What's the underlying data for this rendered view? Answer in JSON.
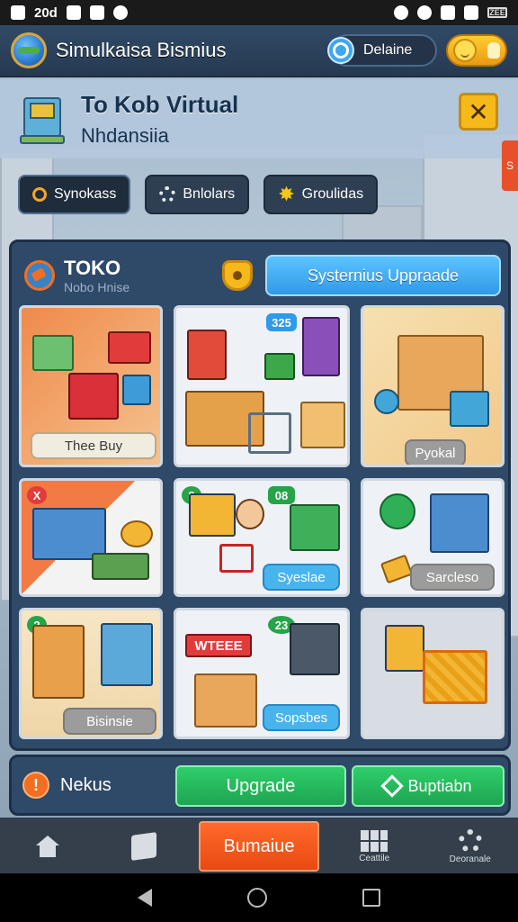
{
  "status_bar": {
    "time": "20d",
    "battery": "ZEE"
  },
  "header": {
    "app_title": "Simulkaisa Bismius",
    "search_label": "Delaine"
  },
  "title_panel": {
    "title": "To Kob Virtual",
    "subtitle": "Nhdansiia",
    "side_tag": "S"
  },
  "chips": [
    {
      "label": "Synokass",
      "icon": "search-icon"
    },
    {
      "label": "Bnlolars",
      "icon": "gear-icon"
    },
    {
      "label": "Groulidas",
      "icon": "star-icon"
    }
  ],
  "store": {
    "title": "TOKO",
    "subtitle": "Nobo Hnise",
    "upgrade_button": "Systernius Uppraade"
  },
  "cards": [
    {
      "label": "Thee Buy",
      "label_style": "cream"
    },
    {
      "label": "",
      "badge": "325"
    },
    {
      "label": "Pyokal",
      "label_style": "grey"
    },
    {
      "label": "",
      "badge": "X"
    },
    {
      "label": "Syeslae",
      "label_style": "blue",
      "badge": "8",
      "badge2": "08"
    },
    {
      "label": "Sarcleso",
      "label_style": "grey"
    },
    {
      "label": "Bisinsie",
      "label_style": "grey",
      "badge": "2"
    },
    {
      "label": "Sopsbes",
      "label_style": "blue",
      "badge": "23",
      "sign": "WTEEE"
    },
    {
      "label": ""
    }
  ],
  "actions": {
    "info_label": "Nekus",
    "upgrade_button": "Upgrade",
    "duplicate_button": "Buptiabn"
  },
  "bottom_nav": {
    "center_button": "Bumaiue",
    "item4_label": "Ceattile",
    "item5_label": "Deoranale"
  },
  "colors": {
    "accent_blue": "#2f9ae8",
    "accent_green": "#1ea552",
    "accent_orange": "#e84a12",
    "gold": "#f5b919"
  }
}
